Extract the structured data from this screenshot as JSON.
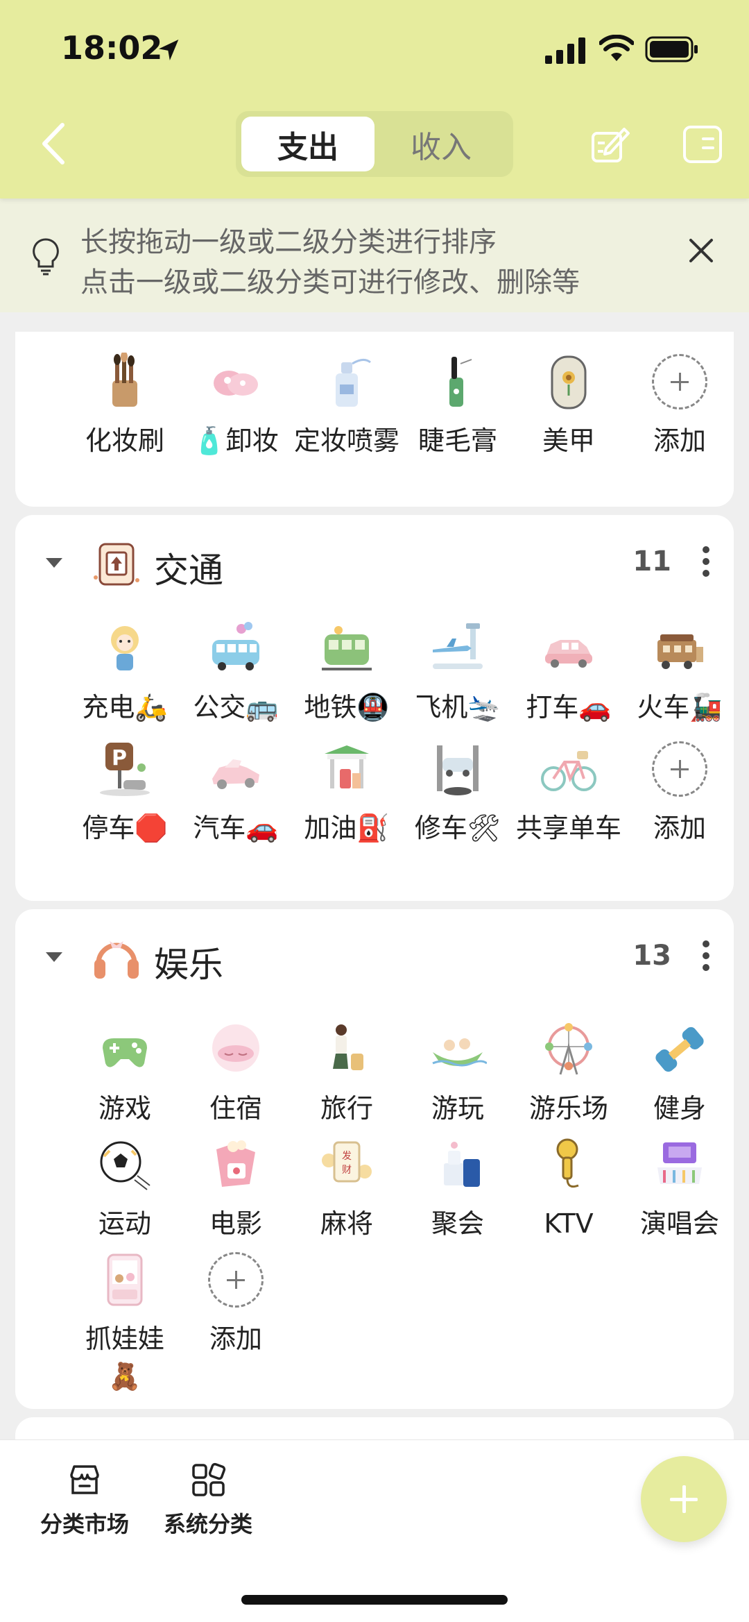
{
  "status_bar": {
    "time": "18:02"
  },
  "header": {
    "tabs": [
      {
        "label": "支出",
        "active": true
      },
      {
        "label": "收入",
        "active": false
      }
    ],
    "accent_color": "#e6ec9e"
  },
  "tip": {
    "line1": "长按拖动一级或二级分类进行排序",
    "line2": "点击一级或二级分类可进行修改、删除等"
  },
  "makeup_partial": {
    "items": [
      {
        "label": "化妆刷",
        "icon": "makeup-brush-icon"
      },
      {
        "label": "🧴卸妆",
        "icon": "makeup-remover-icon"
      },
      {
        "label": "定妆喷雾",
        "icon": "setting-spray-icon"
      },
      {
        "label": "睫毛膏",
        "icon": "mascara-icon"
      },
      {
        "label": "美甲",
        "icon": "nail-icon"
      },
      {
        "label": "添加",
        "icon": "add-icon"
      }
    ]
  },
  "transport": {
    "title": "交通",
    "count": "11",
    "items": [
      {
        "label": "充电🛵",
        "icon": "charging-icon"
      },
      {
        "label": "公交🚌",
        "icon": "bus-icon"
      },
      {
        "label": "地铁🚇",
        "icon": "subway-icon"
      },
      {
        "label": "飞机🛬",
        "icon": "plane-icon"
      },
      {
        "label": "打车🚗",
        "icon": "taxi-icon"
      },
      {
        "label": "火车🚂",
        "icon": "train-icon"
      },
      {
        "label": "停车🛑",
        "icon": "parking-icon"
      },
      {
        "label": "汽车🚗",
        "icon": "car-icon"
      },
      {
        "label": "加油⛽",
        "icon": "fuel-icon"
      },
      {
        "label": "修车🛠",
        "icon": "repair-icon"
      },
      {
        "label": "共享单车",
        "icon": "bike-icon"
      },
      {
        "label": "添加",
        "icon": "add-icon"
      }
    ]
  },
  "entertainment": {
    "title": "娱乐",
    "count": "13",
    "items": [
      {
        "label": "游戏",
        "icon": "gamepad-icon"
      },
      {
        "label": "住宿",
        "icon": "sleep-mask-icon"
      },
      {
        "label": "旅行",
        "icon": "travel-icon"
      },
      {
        "label": "游玩",
        "icon": "boat-icon"
      },
      {
        "label": "游乐场",
        "icon": "ferris-wheel-icon"
      },
      {
        "label": "健身",
        "icon": "dumbbell-icon"
      },
      {
        "label": "运动",
        "icon": "soccer-ball-icon"
      },
      {
        "label": "电影",
        "icon": "popcorn-icon"
      },
      {
        "label": "麻将",
        "icon": "mahjong-icon"
      },
      {
        "label": "聚会",
        "icon": "cake-icon"
      },
      {
        "label": "KTV",
        "icon": "microphone-icon"
      },
      {
        "label": "演唱会",
        "icon": "concert-icon"
      },
      {
        "label": "抓娃娃🧸",
        "icon": "claw-machine-icon"
      },
      {
        "label": "添加",
        "icon": "add-icon"
      }
    ]
  },
  "bottom_bar": {
    "market_label": "分类市场",
    "system_label": "系统分类"
  }
}
